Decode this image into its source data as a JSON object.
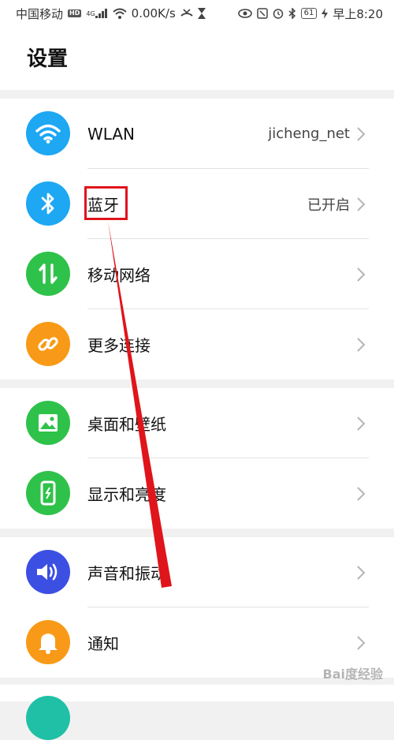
{
  "status_bar": {
    "carrier": "中国移动",
    "hd": "HD",
    "network": "4G",
    "speed": "0.00K/s",
    "battery": "61",
    "time": "早上8:20"
  },
  "header": {
    "title": "设置"
  },
  "groups": [
    {
      "items": [
        {
          "label": "WLAN",
          "value": "jicheng_net",
          "icon": "wifi-icon",
          "color": "#1ea7f2"
        },
        {
          "label": "蓝牙",
          "value": "已开启",
          "icon": "bluetooth-icon",
          "color": "#1ea7f2"
        },
        {
          "label": "移动网络",
          "value": "",
          "icon": "mobile-data-icon",
          "color": "#2fc24a"
        },
        {
          "label": "更多连接",
          "value": "",
          "icon": "link-icon",
          "color": "#f89a17"
        }
      ]
    },
    {
      "items": [
        {
          "label": "桌面和壁纸",
          "value": "",
          "icon": "wallpaper-icon",
          "color": "#2fc24a"
        },
        {
          "label": "显示和亮度",
          "value": "",
          "icon": "display-icon",
          "color": "#2fc24a"
        }
      ]
    },
    {
      "items": [
        {
          "label": "声音和振动",
          "value": "",
          "icon": "sound-icon",
          "color": "#3c4fe3"
        },
        {
          "label": "通知",
          "value": "",
          "icon": "bell-icon",
          "color": "#f89a17"
        }
      ]
    }
  ],
  "watermark": "Bai度经验"
}
